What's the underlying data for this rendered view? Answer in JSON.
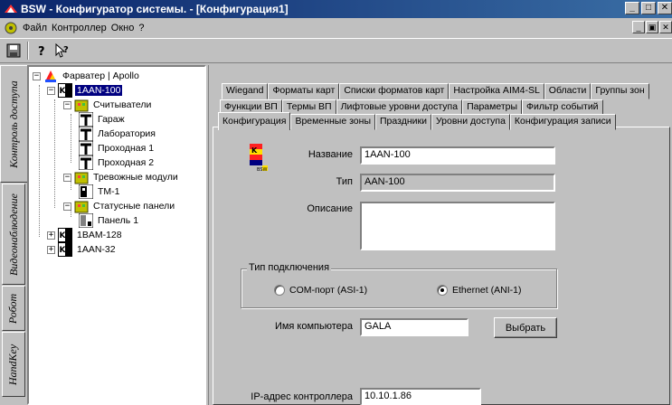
{
  "window": {
    "title": "BSW - Конфигуратор системы. - [Конфигурация1]",
    "buttons": [
      "_",
      "□",
      "✕"
    ]
  },
  "menu": {
    "items": [
      "Файл",
      "Контроллер",
      "Окно",
      "?"
    ],
    "mdi_buttons": [
      "_",
      "▣",
      "✕"
    ]
  },
  "vertical_tabs": [
    "Контроль доступа",
    "Видеонаблюдение",
    "Робот",
    "HandKey"
  ],
  "tree": {
    "root": "Фарватер | Apollo",
    "controller": "1AAN-100",
    "readers_group": "Считыватели",
    "readers": [
      "Гараж",
      "Лаборатория",
      "Проходная 1",
      "Проходная 2"
    ],
    "alarm_group": "Тревожные модули",
    "alarm_items": [
      "ТМ-1"
    ],
    "status_group": "Статусные панели",
    "status_items": [
      "Панель 1"
    ],
    "other_controllers": [
      "1BAM-128",
      "1AAN-32"
    ]
  },
  "tabs": {
    "row1": [
      "Wiegand",
      "Форматы карт",
      "Списки форматов карт",
      "Настройка AIM4-SL",
      "Области",
      "Группы зон"
    ],
    "row2": [
      "Функции ВП",
      "Термы ВП",
      "Лифтовые уровни доступа",
      "Параметры",
      "Фильтр событий"
    ],
    "row3": [
      "Конфигурация",
      "Временные зоны",
      "Праздники",
      "Уровни доступа",
      "Конфигурация записи"
    ],
    "active": "Конфигурация"
  },
  "form": {
    "name_label": "Название",
    "name_value": "1AAN-100",
    "type_label": "Тип",
    "type_value": "AAN-100",
    "description_label": "Описание",
    "description_value": "",
    "connection_legend": "Тип подключения",
    "connection_options": [
      "COM-порт (ASI-1)",
      "Ethernet (ANI-1)"
    ],
    "connection_selected": "Ethernet (ANI-1)",
    "computer_label": "Имя компьютера",
    "computer_value": "GALA",
    "select_button": "Выбрать",
    "ip_label": "IP-адрес контроллера",
    "ip_value": "10.10.1.86"
  },
  "logo_text": "BSW",
  "colors": {
    "titlebar_start": "#0a246a",
    "titlebar_end": "#3a6ea5",
    "selection": "#000080",
    "face": "#c0c0c0"
  }
}
